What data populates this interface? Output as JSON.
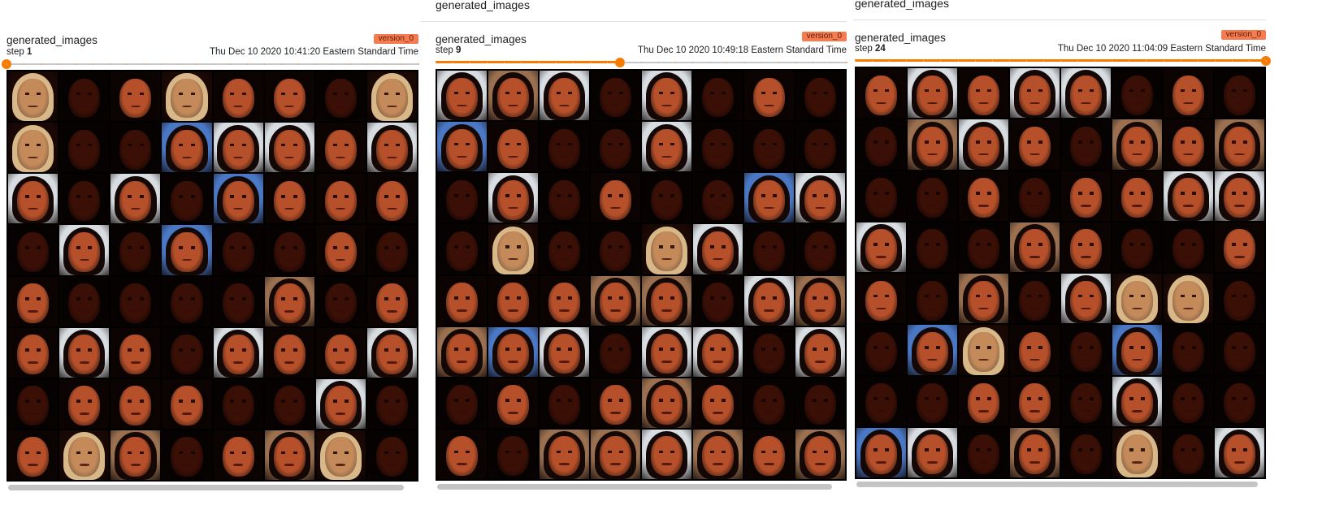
{
  "panels": [
    {
      "top_label": "",
      "title": "generated_images",
      "run_badge": "version_0",
      "step_label": "step",
      "step_value": "1",
      "timestamp": "Thu Dec 10 2020 10:41:20 Eastern Standard Time",
      "slider_progress": 0.0
    },
    {
      "top_label": "generated_images",
      "title": "generated_images",
      "run_badge": "version_0",
      "step_label": "step",
      "step_value": "9",
      "timestamp": "Thu Dec 10 2020 10:49:18 Eastern Standard Time",
      "slider_progress": 0.448
    },
    {
      "top_label": "generated_images",
      "title": "generated_images",
      "run_badge": "version_0",
      "step_label": "step",
      "step_value": "24",
      "timestamp": "Thu Dec 10 2020 11:04:09 Eastern Standard Time",
      "slider_progress": 1.0
    }
  ],
  "grid": {
    "rows": 8,
    "cols": 8,
    "tile_content": "generated face sample",
    "palette": {
      "background": "#000000",
      "dark_face": "#3a0f06",
      "warm_face": "#b5502a",
      "pale_backdrop": "#d8dde2",
      "blue_backdrop": "#4a78c4",
      "tan_backdrop": "#9a7050",
      "blonde_hair": "#d8b888",
      "dark_hair": "#140806"
    }
  },
  "colors": {
    "accent": "#f57c00",
    "badge_bg": "#f57c50",
    "track": "#c8c8c8"
  }
}
